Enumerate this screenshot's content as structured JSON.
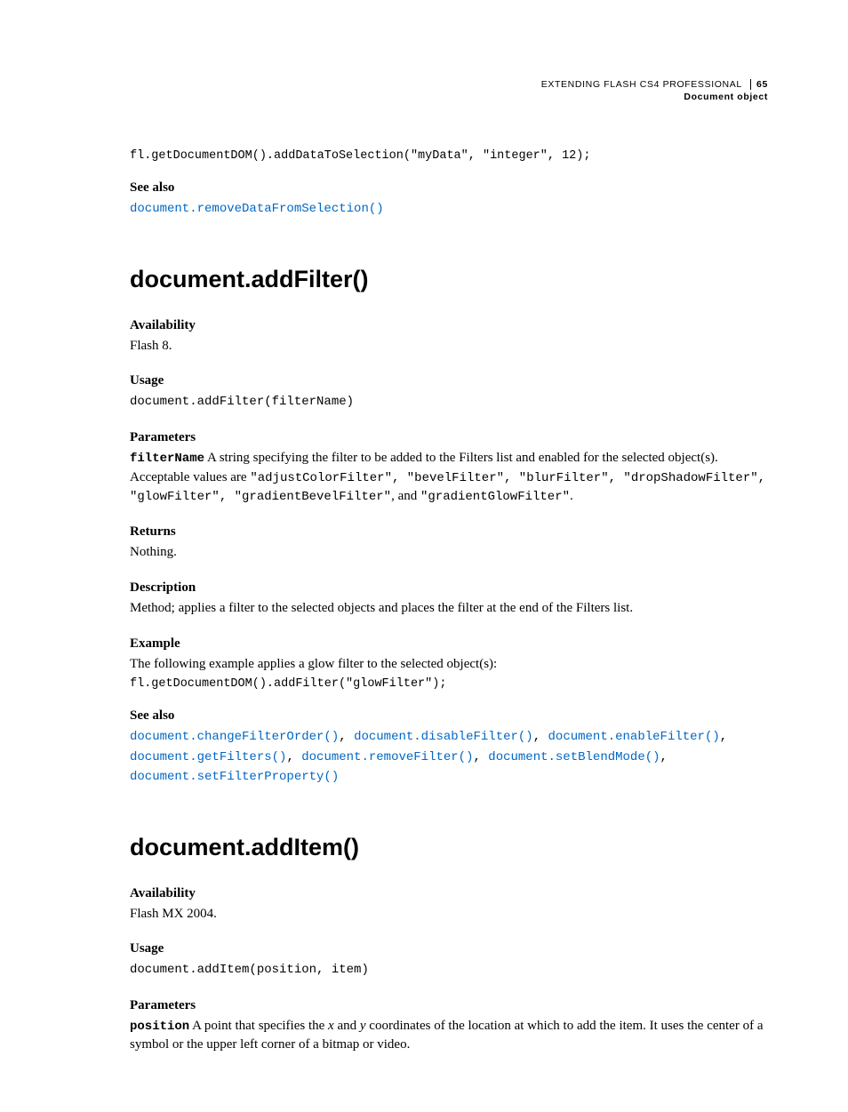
{
  "header": {
    "book_title": "EXTENDING FLASH CS4 PROFESSIONAL",
    "page_number": "65",
    "chapter": "Document object"
  },
  "top_code": "fl.getDocumentDOM().addDataToSelection(\"myData\", \"integer\", 12);",
  "see_also_1": {
    "heading": "See also",
    "link": "document.removeDataFromSelection()"
  },
  "addFilter": {
    "title": "document.addFilter()",
    "availability_h": "Availability",
    "availability_t": "Flash 8.",
    "usage_h": "Usage",
    "usage_code": "document.addFilter(filterName)",
    "parameters_h": "Parameters",
    "param_name": "filterName",
    "param_lead": "  A string specifying the filter to be added to the Filters list and enabled for the selected object(s). Acceptable values are ",
    "param_codes": "\"adjustColorFilter\", \"bevelFilter\", \"blurFilter\", \"dropShadowFilter\", \"glowFilter\", \"gradientBevelFilter\"",
    "param_mid": ", and ",
    "param_codes2": "\"gradientGlowFilter\"",
    "param_end": ".",
    "returns_h": "Returns",
    "returns_t": "Nothing.",
    "description_h": "Description",
    "description_t": "Method; applies a filter to the selected objects and places the filter at the end of the Filters list.",
    "example_h": "Example",
    "example_t": "The following example applies a glow filter to the selected object(s):",
    "example_code": "fl.getDocumentDOM().addFilter(\"glowFilter\");",
    "see_also_h": "See also",
    "see_also_links": [
      "document.changeFilterOrder()",
      "document.disableFilter()",
      "document.enableFilter()",
      "document.getFilters()",
      "document.removeFilter()",
      "document.setBlendMode()",
      "document.setFilterProperty()"
    ]
  },
  "addItem": {
    "title": "document.addItem()",
    "availability_h": "Availability",
    "availability_t": "Flash MX 2004.",
    "usage_h": "Usage",
    "usage_code": "document.addItem(position, item)",
    "parameters_h": "Parameters",
    "param_name": "position",
    "param_lead1": "  A point that specifies the ",
    "param_x": "x",
    "param_mid1": " and ",
    "param_y": "y",
    "param_tail": " coordinates of the location at which to add the item. It uses the center of a symbol or the upper left corner of a bitmap or video."
  }
}
